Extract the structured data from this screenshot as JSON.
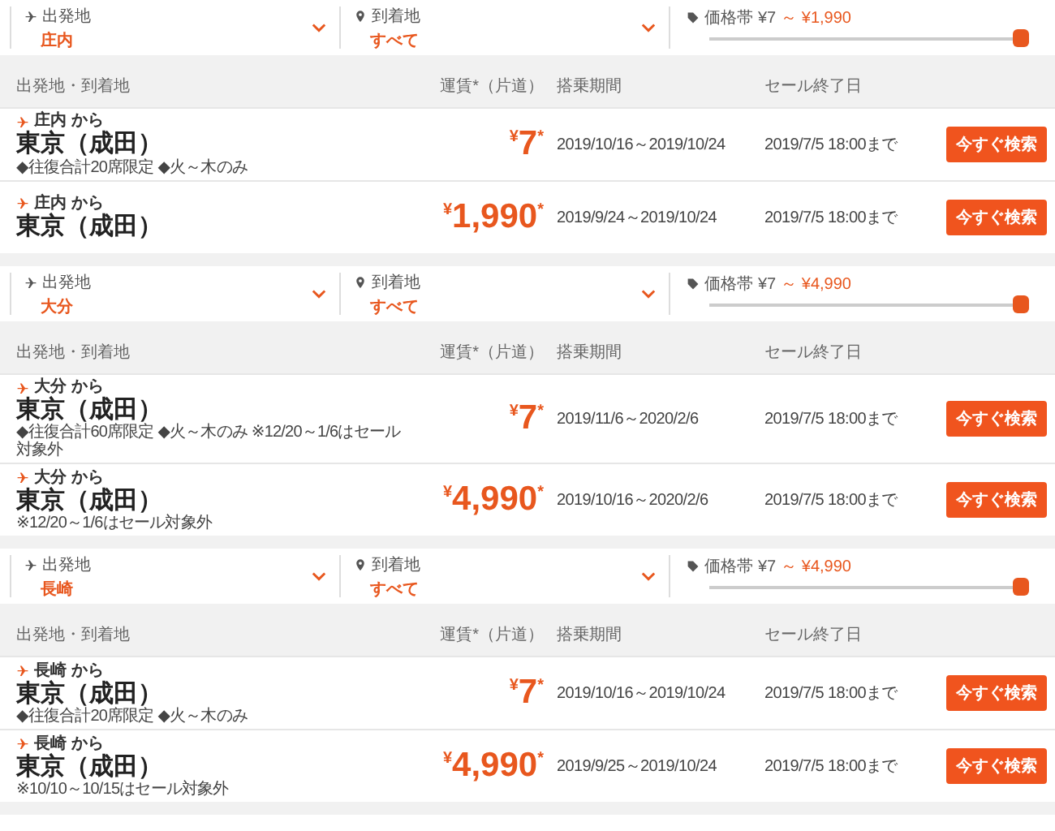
{
  "sections": [
    {
      "origin": {
        "label": "出発地",
        "value": "庄内"
      },
      "destination": {
        "label": "到着地",
        "value": "すべて"
      },
      "price_range": {
        "label": "価格帯",
        "min": "¥7",
        "max": "～ ¥1,990",
        "level": 1
      },
      "columns": [
        "出発地・到着地",
        "運賃*（片道）",
        "搭乗期間",
        "セール終了日"
      ],
      "rows": [
        {
          "from": "庄内 から",
          "to": "東京（成田）",
          "note": "◆往復合計20席限定 ◆火～木のみ",
          "fare": "$^{¥}$7$^{*}$",
          "period": "2019/10/16～2019/10/24",
          "sale_end": "2019/7/5 18:00まで",
          "button": "今すぐ検索"
        },
        {
          "from": "庄内 から",
          "to": "東京（成田）",
          "fare": "$^{¥}$1,990$^{*}$",
          "period": "2019/9/24～2019/10/24",
          "sale_end": "2019/7/5 18:00まで",
          "button": "今すぐ検索"
        }
      ]
    },
    {
      "origin": {
        "label": "出発地",
        "value": "大分"
      },
      "destination": {
        "label": "到着地",
        "value": "すべて"
      },
      "price_range": {
        "label": "価格帯",
        "min": "¥7",
        "max": "～ ¥4,990",
        "level": 1
      },
      "columns": [
        "出発地・到着地",
        "運賃*（片道）",
        "搭乗期間",
        "セール終了日"
      ],
      "rows": [
        {
          "from": "大分 から",
          "to": "東京（成田）",
          "note": "◆往復合計60席限定 ◆火～木のみ ※12/20～1/6はセール対象外",
          "fare": "$^{¥}$7$^{*}$",
          "period": "2019/11/6～2020/2/6",
          "sale_end": "2019/7/5 18:00まで",
          "button": "今すぐ検索"
        },
        {
          "from": "大分 から",
          "to": "東京（成田）",
          "note": "※12/20～1/6はセール対象外",
          "fare": "$^{¥}$4,990$^{*}$",
          "period": "2019/10/16～2020/2/6",
          "sale_end": "2019/7/5 18:00まで",
          "button": "今すぐ検索"
        }
      ]
    },
    {
      "origin": {
        "label": "出発地",
        "value": "長崎"
      },
      "destination": {
        "label": "到着地",
        "value": "すべて"
      },
      "price_range": {
        "label": "価格帯",
        "min": "¥7",
        "max": "～ ¥4,990",
        "level": 1
      },
      "columns": [
        "出発地・到着地",
        "運賃*（片道）",
        "搭乗期間",
        "セール終了日"
      ],
      "rows": [
        {
          "from": "長崎 から",
          "to": "東京（成田）",
          "note": "◆往復合計20席限定 ◆火～木のみ",
          "fare": "$^{¥}$7$^{*}$",
          "period": "2019/10/16～2019/10/24",
          "sale_end": "2019/7/5 18:00まで",
          "button": "今すぐ検索"
        },
        {
          "from": "長崎 から",
          "to": "東京（成田）",
          "note": "※10/10～10/15はセール対象外",
          "fare": "$^{¥}$4,990$^{*}$",
          "period": "2019/9/25～2019/10/24",
          "sale_end": "2019/7/5 18:00まで",
          "button": "今すぐ検索"
        }
      ]
    }
  ]
}
